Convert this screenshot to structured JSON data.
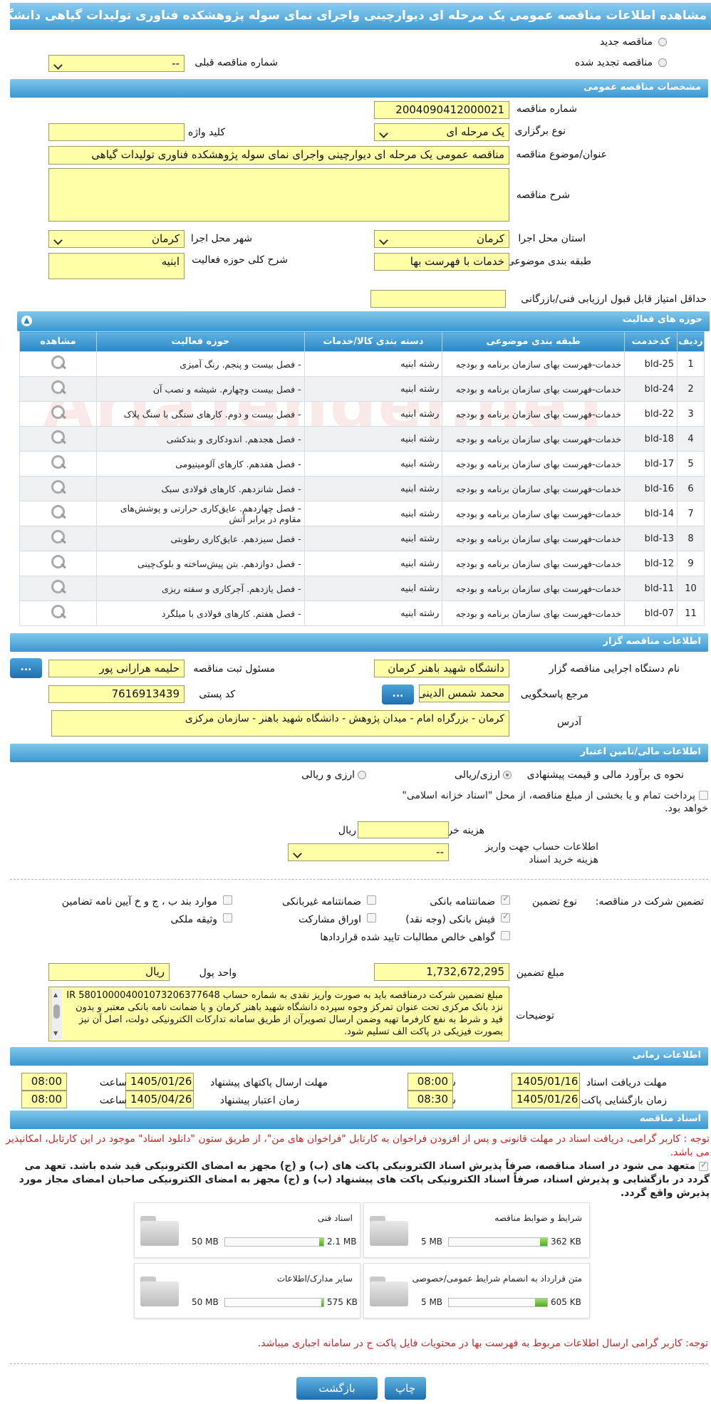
{
  "header": {
    "title": "مشاهده اطلاعات مناقصه عمومی یک مرحله ای دیوارچینی واجرای نمای سوله پژوهشکده فناوری تولیدات گیاهی دانشگاه شهیدباهنرکرمان"
  },
  "top": {
    "new_tender": "مناقصه جدید",
    "renewed_tender": "مناقصه تجدید شده",
    "prev_number_label": "شماره مناقصه قبلی",
    "prev_number_value": "--"
  },
  "general": {
    "section": "مشخصات مناقصه عمومی",
    "number_label": "شماره مناقصه",
    "number": "2004090412000021",
    "type_label": "نوع برگزاری",
    "type": "یک مرحله ای",
    "keyword_label": "کلید واژه",
    "keyword": "",
    "subject_label": "عنوان/موضوع مناقصه",
    "subject": "مناقصه عمومی یک مرحله ای دیوارچینی واجرای نمای سوله پژوهشکده فناوری تولیدات گیاهی",
    "desc_label": "شرح مناقصه",
    "desc": "",
    "province_label": "استان محل اجرا",
    "province": "کرمان",
    "city_label": "شهر محل اجرا",
    "city": "کرمان",
    "category_label": "طبقه بندی موضوعی",
    "category": "خدمات با فهرست بها",
    "scope_label": "شرح کلی حوزه فعالیت",
    "scope": "ابنیه",
    "min_score_label": "حداقل امتیاز قابل قبول ارزیابی فنی/بازرگانی",
    "min_score": ""
  },
  "activities": {
    "title": "حوزه های فعالیت",
    "headers": [
      "ردیف",
      "کدخدمت",
      "طبقه بندی موضوعی",
      "دسته بندی کالا/خدمات",
      "حوزه فعالیت",
      "مشاهده"
    ],
    "rows": [
      {
        "n": "1",
        "code": "bld-25",
        "cat": "خدمات-فهرست بهای سازمان برنامه و بودجه",
        "group": "رشته ابنیه",
        "field": "- فصل بیست و پنجم. رنگ آمیزی"
      },
      {
        "n": "2",
        "code": "bld-24",
        "cat": "خدمات-فهرست بهای سازمان برنامه و بودجه",
        "group": "رشته ابنیه",
        "field": "- فصل بیست وچهارم. شیشه و نصب آن"
      },
      {
        "n": "3",
        "code": "bld-22",
        "cat": "خدمات-فهرست بهای سازمان برنامه و بودجه",
        "group": "رشته ابنیه",
        "field": "- فصل بیست و دوم. کارهای سنگی با سنگ پلاک"
      },
      {
        "n": "4",
        "code": "bld-18",
        "cat": "خدمات-فهرست بهای سازمان برنامه و بودجه",
        "group": "رشته ابنیه",
        "field": "- فصل هجدهم. اندودکاری و بندکشی"
      },
      {
        "n": "5",
        "code": "bld-17",
        "cat": "خدمات-فهرست بهای سازمان برنامه و بودجه",
        "group": "رشته ابنیه",
        "field": "- فصل هفدهم. کارهای آلومینیومی"
      },
      {
        "n": "6",
        "code": "bld-16",
        "cat": "خدمات-فهرست بهای سازمان برنامه و بودجه",
        "group": "رشته ابنیه",
        "field": "- فصل شانزدهم. کارهای فولادی سبک"
      },
      {
        "n": "7",
        "code": "bld-14",
        "cat": "خدمات-فهرست بهای سازمان برنامه و بودجه",
        "group": "رشته ابنیه",
        "field": "- فصل چهاردهم. عایق‌کاری حرارتی و پوشش‌های مقاوم در برابر آتش"
      },
      {
        "n": "8",
        "code": "bld-13",
        "cat": "خدمات-فهرست بهای سازمان برنامه و بودجه",
        "group": "رشته ابنیه",
        "field": "- فصل سیزدهم. عایق‌کاری رطوبتی"
      },
      {
        "n": "9",
        "code": "bld-12",
        "cat": "خدمات-فهرست بهای سازمان برنامه و بودجه",
        "group": "رشته ابنیه",
        "field": "- فصل دوازدهم. بتن پیش‌ساخته و بلوک‌چینی"
      },
      {
        "n": "10",
        "code": "bld-11",
        "cat": "خدمات-فهرست بهای سازمان برنامه و بودجه",
        "group": "رشته ابنیه",
        "field": "- فصل یازدهم. آجرکاری و سفته ریزی"
      },
      {
        "n": "11",
        "code": "bld-07",
        "cat": "خدمات-فهرست بهای سازمان برنامه و بودجه",
        "group": "رشته ابنیه",
        "field": "- فصل هفتم. کارهای فولادی با میلگرد"
      }
    ]
  },
  "organizer": {
    "section": "اطلاعات مناقصه گزار",
    "agency_label": "نام دستگاه اجرایی مناقصه گزار",
    "agency": "دانشگاه شهید باهنر کرمان",
    "registrar_label": "مسئول ثبت مناقصه",
    "registrar": "حلیمه هرارانی پور",
    "contact_label": "مرجع پاسخگویی",
    "contact": "محمد شمس الدینی",
    "postal_label": "کد پستی",
    "postal": "7616913439",
    "address_label": "آدرس",
    "address": "کرمان - بزرگراه امام - میدان پژوهش - دانشگاه شهید باهنر - سازمان مرکزی",
    "dots": "..."
  },
  "finance": {
    "section": "اطلاعات مالی/تامین اعتبار",
    "method_label": "نحوه ی برآورد مالی و قیمت پیشنهادی",
    "opt1": "ارزی/ریالی",
    "opt2": "ارزی و ریالی",
    "treasury_text": "پرداخت تمام و یا بخشی از مبلغ مناقصه، از محل \"اسناد خزانه اسلامی\" خواهد بود.",
    "doc_cost_label": "هزینه خرید اسناد",
    "doc_cost_unit": "ریال",
    "account_label": "اطلاعات حساب جهت واریز هزینه خرید اسناد",
    "account": "--"
  },
  "guarantee": {
    "label": "تضمین شرکت در مناقصه:",
    "type_label": "نوع تضمین",
    "opts": [
      "ضمانتنامه بانکی",
      "ضمانتنامه غیربانکی",
      "موارد بند ب ، ج و خ آیین نامه تضامین",
      "فیش بانکی (وجه نقد)",
      "اوراق مشارکت",
      "وثیقه ملکی",
      "گواهی خالص مطالبات تایید شده قراردادها"
    ],
    "amount_label": "مبلغ تضمین",
    "amount": "1,732,672,295",
    "unit_label": "واحد پول",
    "unit": "ریال",
    "notes_label": "توضیحات",
    "notes": "مبلغ تضمین شرکت درمناقصه باید به صورت واریز نقدی به شماره حساب IR 580100004001073206377648 نزد بانک مرکزی تحت عنوان تمرکز وجوه سپرده دانشگاه شهید باهنر کرمان و یا ضمانت نامه بانکی معتبر و بدون قید و شرط به نفع کارفرما تهیه وضمن ارسال تصویرآن از طریق سامانه تدارکات الکترونیکی دولت، اصل آن نیز بصورت فیزیکی در پاکت الف تسلیم شود."
  },
  "timing": {
    "section": "اطلاعات زمانی",
    "get_docs_label": "مهلت دریافت اسناد",
    "get_docs_date": "1405/01/16",
    "get_docs_time": "08:00",
    "send_label": "مهلت ارسال پاکتهای پیشنهاد",
    "send_date": "1405/01/26",
    "send_time": "08:00",
    "open_label": "زمان بازگشایی پاکت ها",
    "open_date": "1405/01/26",
    "open_time": "08:30",
    "valid_label": "زمان اعتبار پیشنهاد",
    "valid_date": "1405/04/26",
    "valid_time": "08:00",
    "hour": "ساعت"
  },
  "docs": {
    "section": "اسناد مناقصه",
    "notice": "توجه : کاربر گرامی، دریافت اسناد در مهلت قانونی و پس از افزودن فراخوان به کارتابل \"فراخوان های من\"، از طریق ستون \"دانلود اسناد\" موجود در این کارتابل، امکانپذیر می باشد.",
    "commit": "متعهد می شود در اسناد مناقصه، صرفاً پذیرش اسناد الکترونیکی پاکت های (ب) و (ج) مجهز به امضای الکترونیکی قید شده باشد. تعهد می گردد در بازگشایی و پذیرش اسناد، صرفاً اسناد الکترونیکی پاکت های پیشنهاد (ب) و (ج) مجهز به امضای الکترونیکی صاحبان امضای مجاز مورد پذیرش واقع گردد.",
    "files": [
      {
        "name": "شرایط و ضوابط مناقصه",
        "size": "362 KB",
        "max": "5 MB",
        "fill": 0.07
      },
      {
        "name": "اسناد فنی",
        "size": "2.1 MB",
        "max": "50 MB",
        "fill": 0.04
      },
      {
        "name": "متن قرارداد به انضمام شرایط عمومی/خصوصی",
        "size": "605 KB",
        "max": "5 MB",
        "fill": 0.12
      },
      {
        "name": "سایر مدارک/اطلاعات",
        "size": "575 KB",
        "max": "50 MB",
        "fill": 0.02
      }
    ],
    "footer_note": "توجه: کاربر گرامی ارسال اطلاعات مربوط به فهرست بها در محتویات فایل پاکت ج در سامانه اجباری میباشد."
  },
  "actions": {
    "back": "بازگشت",
    "print": "چاپ"
  },
  "watermark": "AriaTender.neT"
}
